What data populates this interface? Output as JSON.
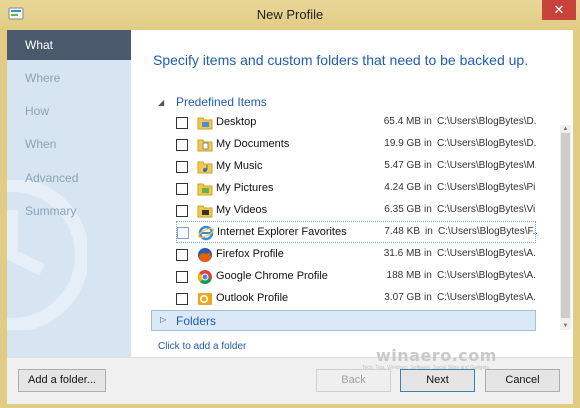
{
  "window": {
    "title": "New Profile",
    "close_glyph": "✕"
  },
  "sidebar": {
    "items": [
      {
        "label": "What",
        "active": true
      },
      {
        "label": "Where",
        "active": false
      },
      {
        "label": "How",
        "active": false
      },
      {
        "label": "When",
        "active": false
      },
      {
        "label": "Advanced",
        "active": false
      },
      {
        "label": "Summary",
        "active": false
      }
    ]
  },
  "main": {
    "heading": "Specify items and custom folders that need to be backed up.",
    "predefined_group": {
      "label": "Predefined Items",
      "expanded": true
    },
    "items": [
      {
        "name": "Desktop",
        "size": "65.4 MB",
        "in": "in",
        "path": "C:\\Users\\BlogBytes\\D...",
        "icon": "desktop-folder-icon",
        "checked": false
      },
      {
        "name": "My Documents",
        "size": "19.9 GB",
        "in": "in",
        "path": "C:\\Users\\BlogBytes\\D...",
        "icon": "documents-folder-icon",
        "checked": false
      },
      {
        "name": "My Music",
        "size": "5.47 GB",
        "in": "in",
        "path": "C:\\Users\\BlogBytes\\M...",
        "icon": "music-folder-icon",
        "checked": false
      },
      {
        "name": "My Pictures",
        "size": "4.24 GB",
        "in": "in",
        "path": "C:\\Users\\BlogBytes\\Pi...",
        "icon": "pictures-folder-icon",
        "checked": false
      },
      {
        "name": "My Videos",
        "size": "6.35 GB",
        "in": "in",
        "path": "C:\\Users\\BlogBytes\\Vi...",
        "icon": "videos-folder-icon",
        "checked": false
      },
      {
        "name": "Internet Explorer Favorites",
        "size": "7.48 KB",
        "in": "in",
        "path": "C:\\Users\\BlogBytes\\F...",
        "icon": "internet-explorer-icon",
        "checked": false,
        "selected": true
      },
      {
        "name": "Firefox Profile",
        "size": "31.6 MB",
        "in": "in",
        "path": "C:\\Users\\BlogBytes\\A...",
        "icon": "firefox-icon",
        "checked": false
      },
      {
        "name": "Google Chrome Profile",
        "size": "188 MB",
        "in": "in",
        "path": "C:\\Users\\BlogBytes\\A...",
        "icon": "chrome-icon",
        "checked": false
      },
      {
        "name": "Outlook Profile",
        "size": "3.07 GB",
        "in": "in",
        "path": "C:\\Users\\BlogBytes\\A...",
        "icon": "outlook-icon",
        "checked": false
      }
    ],
    "folders_group": {
      "label": "Folders",
      "expanded": false
    },
    "add_folder_link": "Click to add a folder"
  },
  "footer": {
    "add_folder_button": "Add a folder...",
    "back_button": "Back",
    "next_button": "Next",
    "cancel_button": "Cancel"
  },
  "watermark": {
    "text": "winaero.com",
    "sub": "Tech, Tips, Windows, Software, Social Sites and Gadgets"
  },
  "colors": {
    "accent": "#1f5db3",
    "sidebar_bg": "#d7e5f2",
    "sidebar_active": "#4a5a6c",
    "frame": "#e1cc84",
    "close": "#c7433a"
  }
}
